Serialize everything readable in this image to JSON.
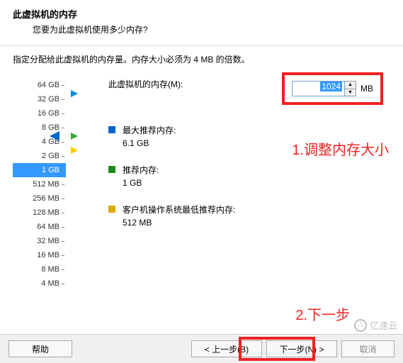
{
  "header": {
    "title": "此虚拟机的内存",
    "subtitle": "您要为此虚拟机使用多少内存?"
  },
  "instruction": "指定分配给此虚拟机的内存量。内存大小必须为 4 MB 的倍数。",
  "memory": {
    "label": "此虚拟机的内存(M):",
    "value": "1024",
    "unit": "MB"
  },
  "ticks": [
    "64 GB",
    "32 GB",
    "16 GB",
    "8 GB",
    "4 GB",
    "2 GB",
    "1 GB",
    "512 MB",
    "256 MB",
    "128 MB",
    "64 MB",
    "32 MB",
    "16 MB",
    "8 MB",
    "4 MB"
  ],
  "selected_tick": "1 GB",
  "recommendations": {
    "max": {
      "label": "最大推荐内存:",
      "value": "6.1 GB"
    },
    "rec": {
      "label": "推荐内存:",
      "value": "1 GB"
    },
    "min": {
      "label": "客户机操作系统最低推荐内存:",
      "value": "512 MB"
    }
  },
  "annotations": {
    "a1": "1.调整内存大小",
    "a2": "2.下一步"
  },
  "buttons": {
    "help": "帮助",
    "back": "< 上一步(B)",
    "next": "下一步(N) >",
    "cancel": "取消"
  },
  "watermark": "亿速云"
}
